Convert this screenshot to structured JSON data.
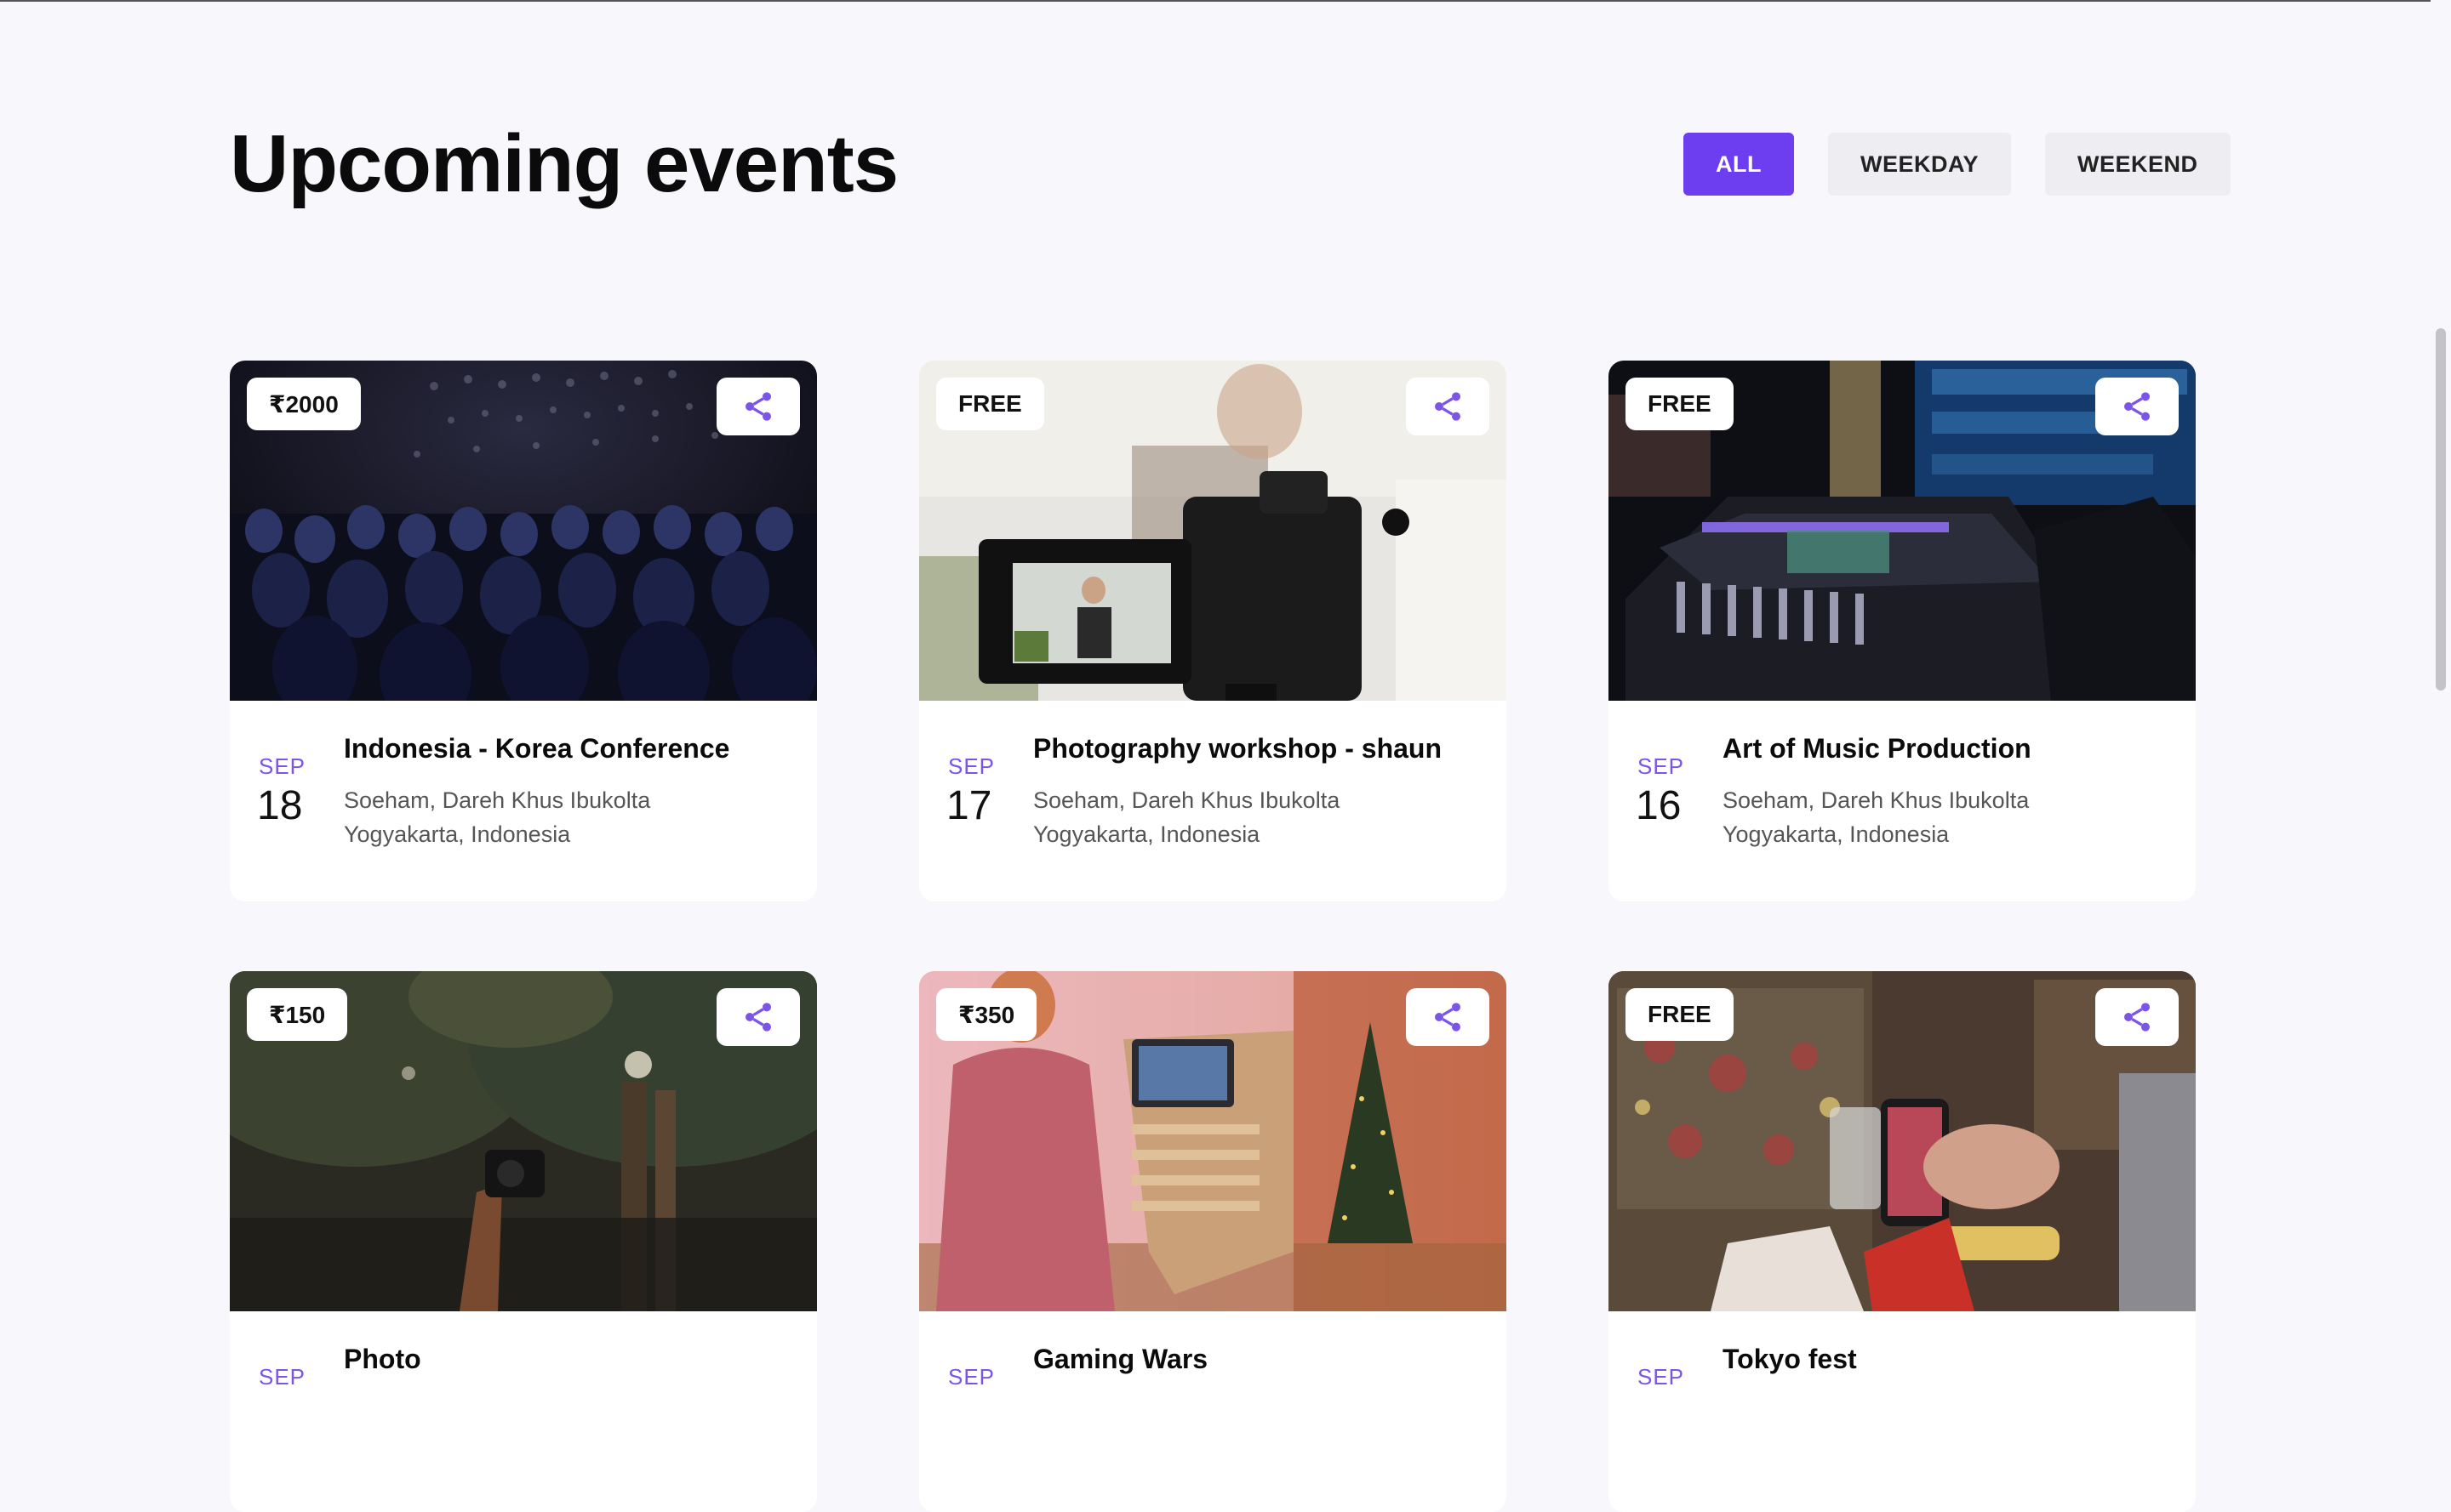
{
  "header": {
    "title": "Upcoming events",
    "filters": [
      {
        "label": "ALL",
        "active": true
      },
      {
        "label": "WEEKDAY",
        "active": false
      },
      {
        "label": "WEEKEND",
        "active": false
      }
    ]
  },
  "colors": {
    "accent": "#6c3ef0",
    "month": "#7b55e8",
    "background": "#f8f7fb"
  },
  "events": [
    {
      "price": "₹2000",
      "month": "SEP",
      "day": "18",
      "title": "Indonesia - Korea Conference",
      "address_line1": "Soeham, Dareh Khus Ibukolta",
      "address_line2": "Yogyakarta, Indonesia"
    },
    {
      "price": "FREE",
      "month": "SEP",
      "day": "17",
      "title": "Photography workshop - shaun",
      "address_line1": "Soeham, Dareh Khus Ibukolta",
      "address_line2": "Yogyakarta, Indonesia"
    },
    {
      "price": "FREE",
      "month": "SEP",
      "day": "16",
      "title": "Art of Music Production",
      "address_line1": "Soeham, Dareh Khus Ibukolta",
      "address_line2": "Yogyakarta, Indonesia"
    },
    {
      "price": "₹150",
      "month": "SEP",
      "day": "",
      "title": "Photo",
      "address_line1": "",
      "address_line2": ""
    },
    {
      "price": "₹350",
      "month": "SEP",
      "day": "",
      "title": "Gaming Wars",
      "address_line1": "",
      "address_line2": ""
    },
    {
      "price": "FREE",
      "month": "SEP",
      "day": "",
      "title": "Tokyo fest",
      "address_line1": "",
      "address_line2": ""
    }
  ],
  "icons": {
    "share": "share-icon"
  }
}
